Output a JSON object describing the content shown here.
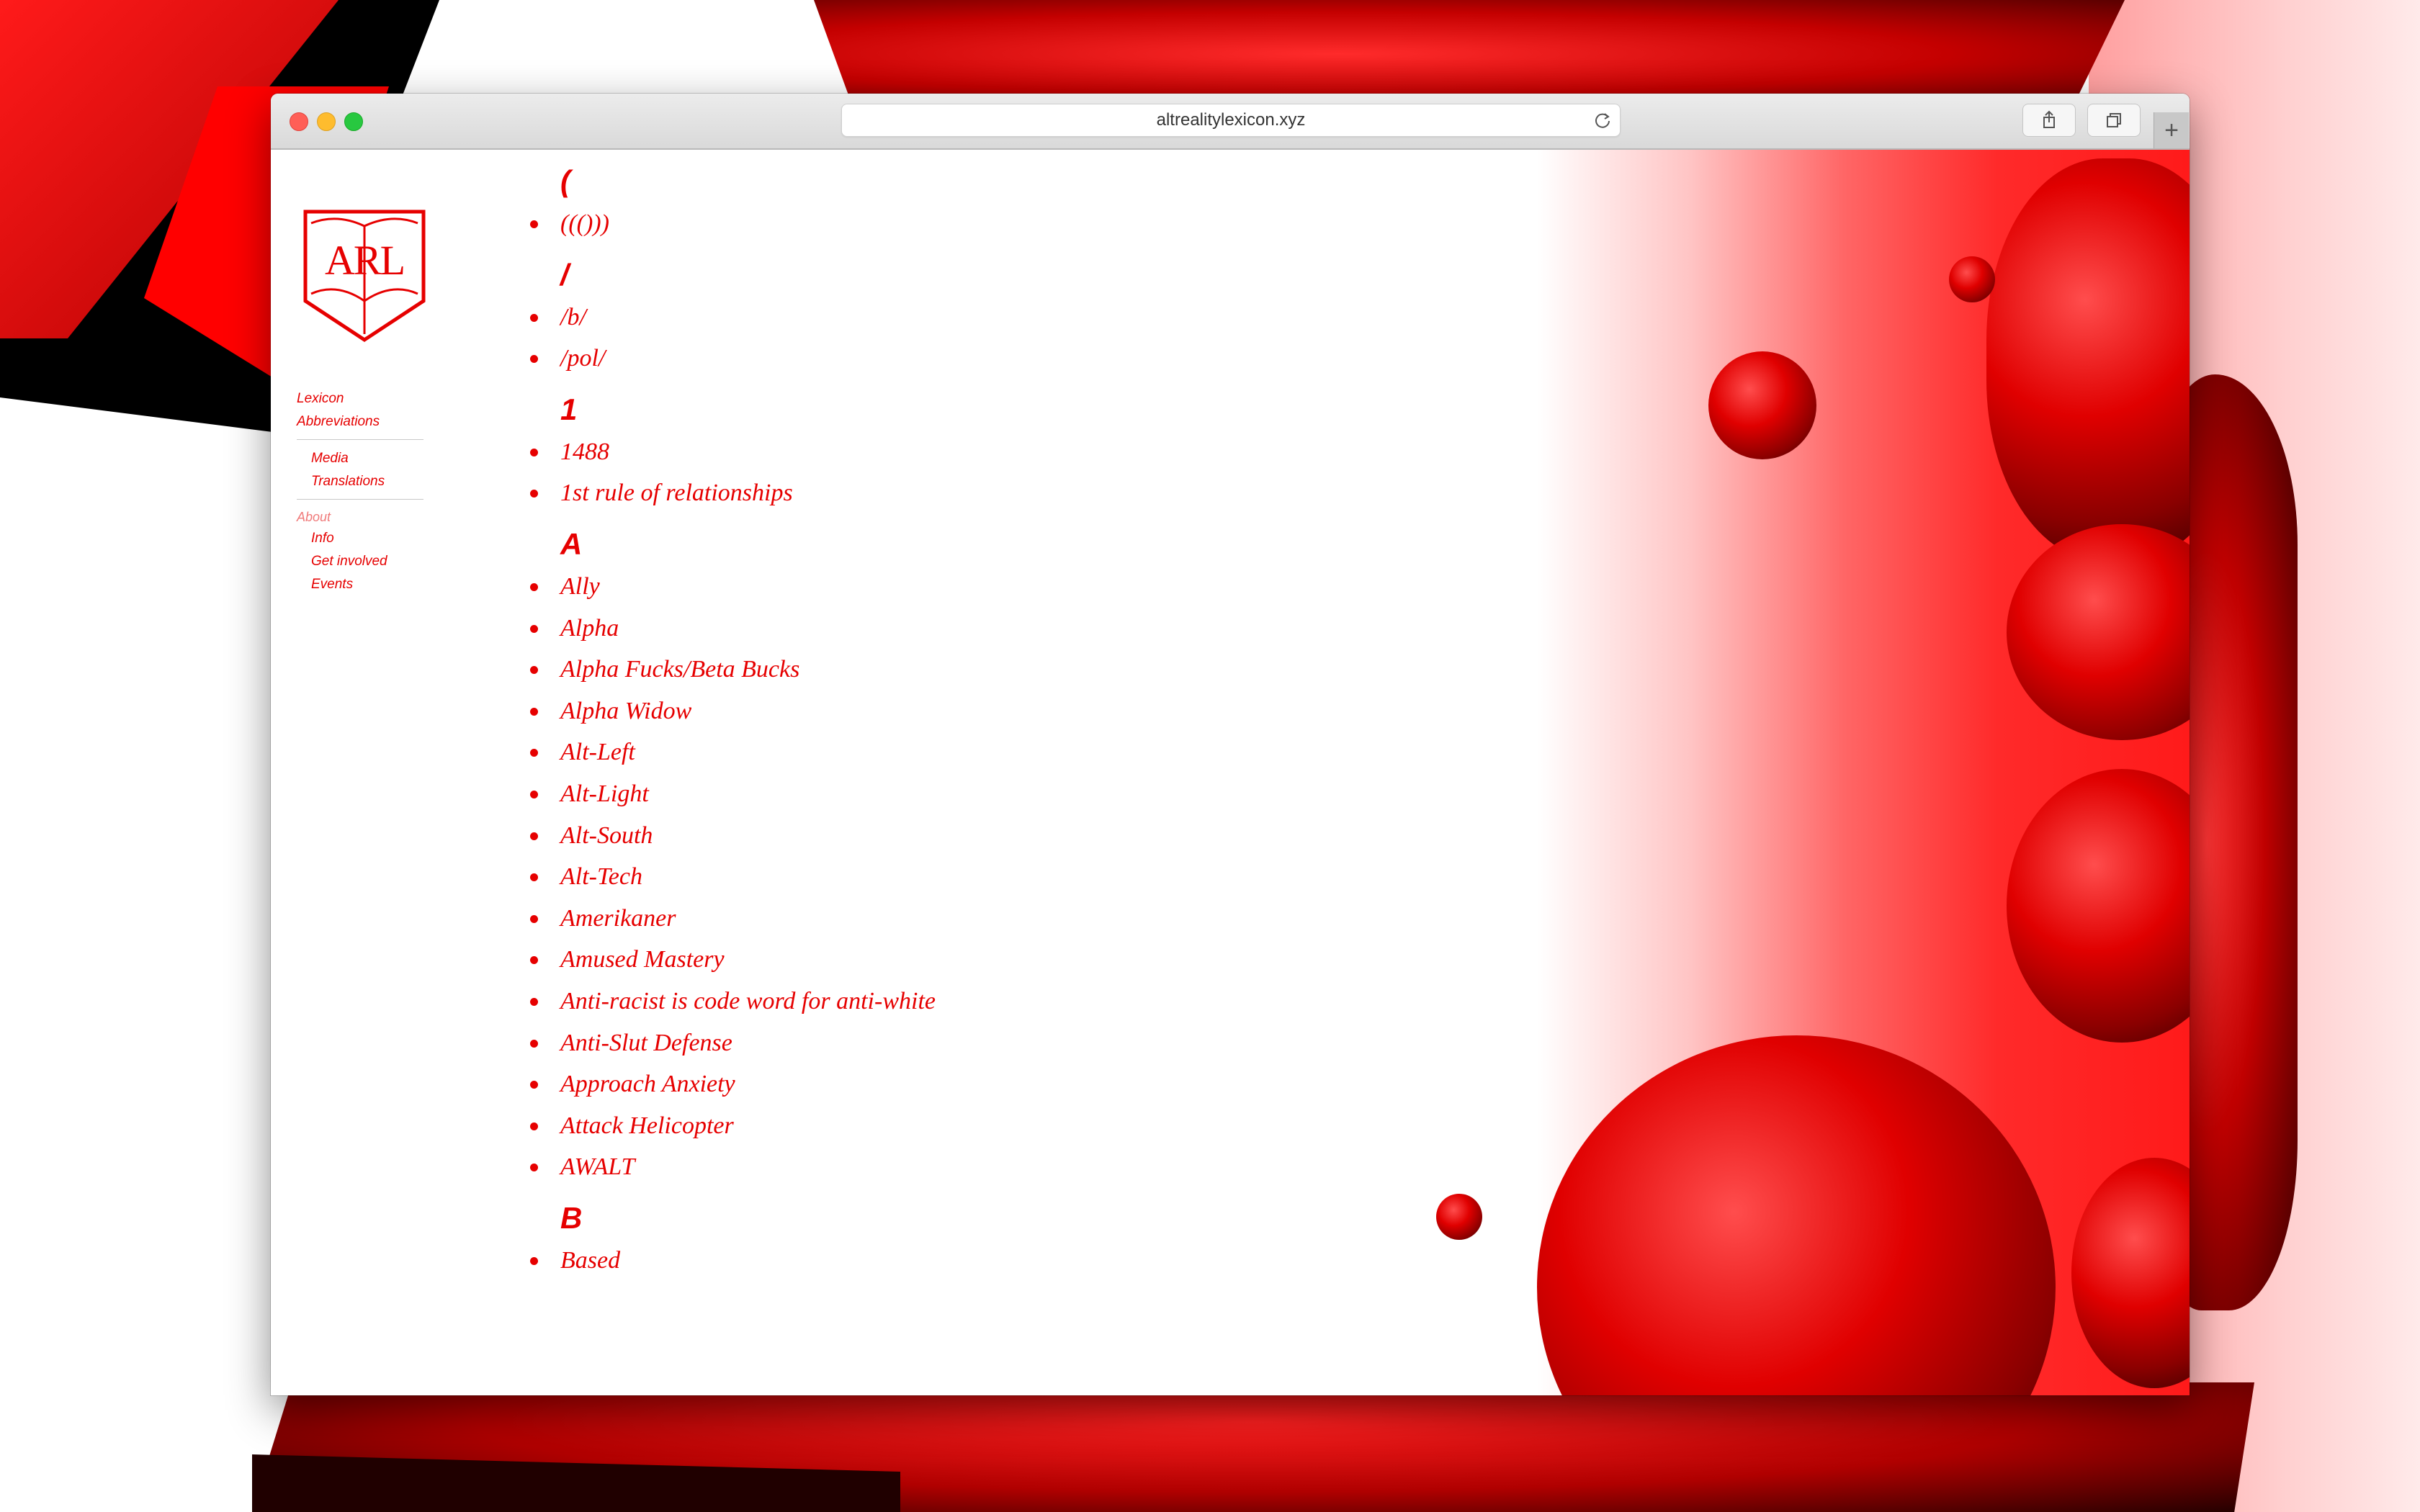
{
  "browser": {
    "url": "altrealitylexicon.xyz",
    "reload_icon": "reload-icon",
    "share_icon": "share-icon",
    "tabs_icon": "tabs-icon",
    "new_tab_icon": "plus-icon"
  },
  "site": {
    "logo_text": "ARL",
    "accent_color": "#e60000"
  },
  "nav": {
    "primary": [
      "Lexicon",
      "Abbreviations"
    ],
    "secondary": [
      "Media",
      "Translations"
    ],
    "about_heading": "About",
    "about_items": [
      "Info",
      "Get involved",
      "Events"
    ]
  },
  "lexicon": [
    {
      "heading": "(",
      "entries": [
        "((()))"
      ]
    },
    {
      "heading": "/",
      "entries": [
        "/b/",
        "/pol/"
      ]
    },
    {
      "heading": "1",
      "entries": [
        "1488",
        "1st rule of relationships"
      ]
    },
    {
      "heading": "A",
      "entries": [
        "Ally",
        "Alpha",
        "Alpha Fucks/Beta Bucks",
        "Alpha Widow",
        "Alt-Left",
        "Alt-Light",
        "Alt-South",
        "Alt-Tech",
        "Amerikaner",
        "Amused Mastery",
        "Anti-racist is code word for anti-white",
        "Anti-Slut Defense",
        "Approach Anxiety",
        "Attack Helicopter",
        "AWALT"
      ]
    },
    {
      "heading": "B",
      "entries": [
        "Based"
      ]
    }
  ]
}
